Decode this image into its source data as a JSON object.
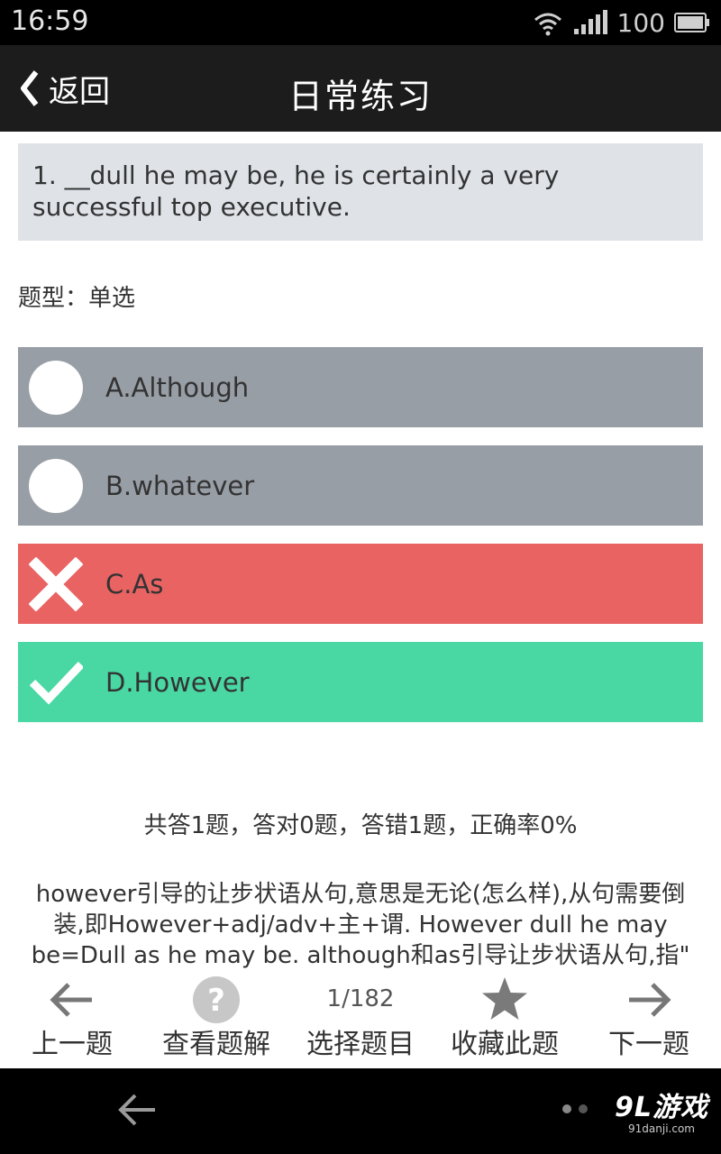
{
  "status_bar": {
    "time": "16:59",
    "battery_level": "100",
    "icons": [
      "wifi-icon",
      "signal-icon",
      "battery-icon"
    ]
  },
  "nav": {
    "back_label": "返回",
    "title": "日常练习"
  },
  "question": {
    "text": "1. __dull he may be, he is certainly a very successful top executive.",
    "type_label": "题型：单选"
  },
  "options": [
    {
      "label": "A.Although",
      "state": "unselected",
      "color": "#989ea6"
    },
    {
      "label": "B.whatever",
      "state": "unselected",
      "color": "#989ea6"
    },
    {
      "label": "C.As",
      "state": "wrong",
      "color": "#e96363"
    },
    {
      "label": "D.However",
      "state": "correct",
      "color": "#49d8a4"
    }
  ],
  "stats": "共答1题，答对0题，答错1题，正确率0%",
  "explanation": "however引导的让步状语从句,意思是无论(怎么样),从句需要倒装,即However+adj/adv+主+谓. However dull he may be=Dull as he may be. although和as引导让步状语从句,指\"",
  "toolbar": {
    "prev_label": "上一题",
    "solution_label": "查看题解",
    "page_count": "1/182",
    "select_label": "选择题目",
    "favorite_label": "收藏此题",
    "next_label": "下一题"
  },
  "watermark": {
    "main": "9L游戏",
    "sub": "91danji.com"
  }
}
